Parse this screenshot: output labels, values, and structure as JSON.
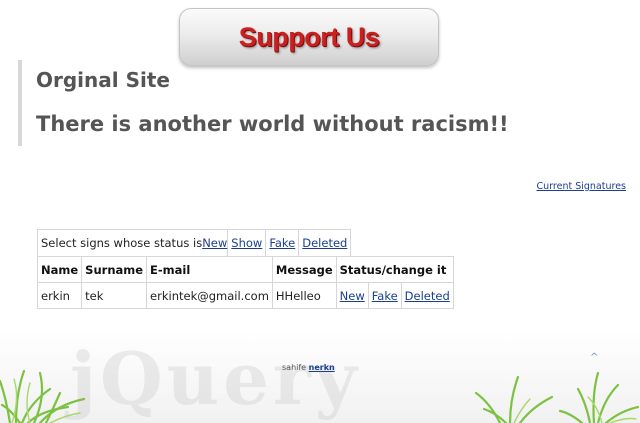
{
  "banner": {
    "label": "Support Us"
  },
  "header": {
    "site_title": "Orginal Site",
    "tagline": "There is another world without racism!!"
  },
  "current_signatures_link": "Current Signatures",
  "filter": {
    "prompt": "Select signs whose status is",
    "links": [
      "New",
      "Show",
      "Fake",
      "Deleted"
    ]
  },
  "table": {
    "headers": [
      "Name",
      "Surname",
      "E-mail",
      "Message",
      "Status/change it"
    ],
    "rows": [
      {
        "name": "erkin",
        "surname": "tek",
        "email": "erkintek@gmail.com",
        "message": "HHelleo",
        "actions": [
          "New",
          "Fake",
          "Deleted"
        ]
      }
    ]
  },
  "footer": {
    "text": "sahife",
    "link": "nerkn",
    "watermark": "jQuery",
    "up_arrow": "^"
  },
  "colors": {
    "banner_text": "#cc1f1f",
    "link": "#1a3f8f",
    "heading": "#555555"
  },
  "icons": [
    "grass-left-icon",
    "grass-right-icon",
    "up-arrow-icon"
  ]
}
